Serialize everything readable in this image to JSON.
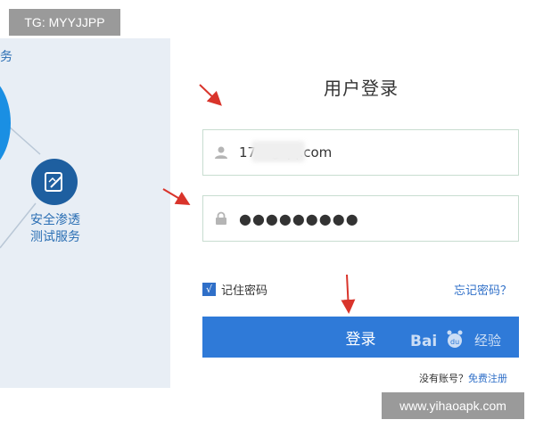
{
  "overlay": {
    "top_tag": "TG: MYYJJPP",
    "bottom_tag": "www.yihaoapk.com"
  },
  "left_panel": {
    "partial_text": "务",
    "service_line1": "安全渗透",
    "service_line2": "测试服务",
    "icon": "edit-document-icon"
  },
  "login": {
    "title": "用户登录",
    "username_value": "17          6@qq.com",
    "password_value": "●●●●●●●●●",
    "user_icon": "user-icon",
    "lock_icon": "lock-icon",
    "remember_label": "记住密码",
    "remember_checked": true,
    "check_mark": "√",
    "forgot_label": "忘记密码？",
    "button_label": "登录",
    "no_account_text": "没有账号？",
    "register_label": "免费注册"
  },
  "watermark": {
    "text": "经验"
  },
  "colors": {
    "accent": "#2f7ad8",
    "link": "#2f6fc8",
    "panel_bg": "#e8eef5",
    "arrow": "#d9342b"
  }
}
